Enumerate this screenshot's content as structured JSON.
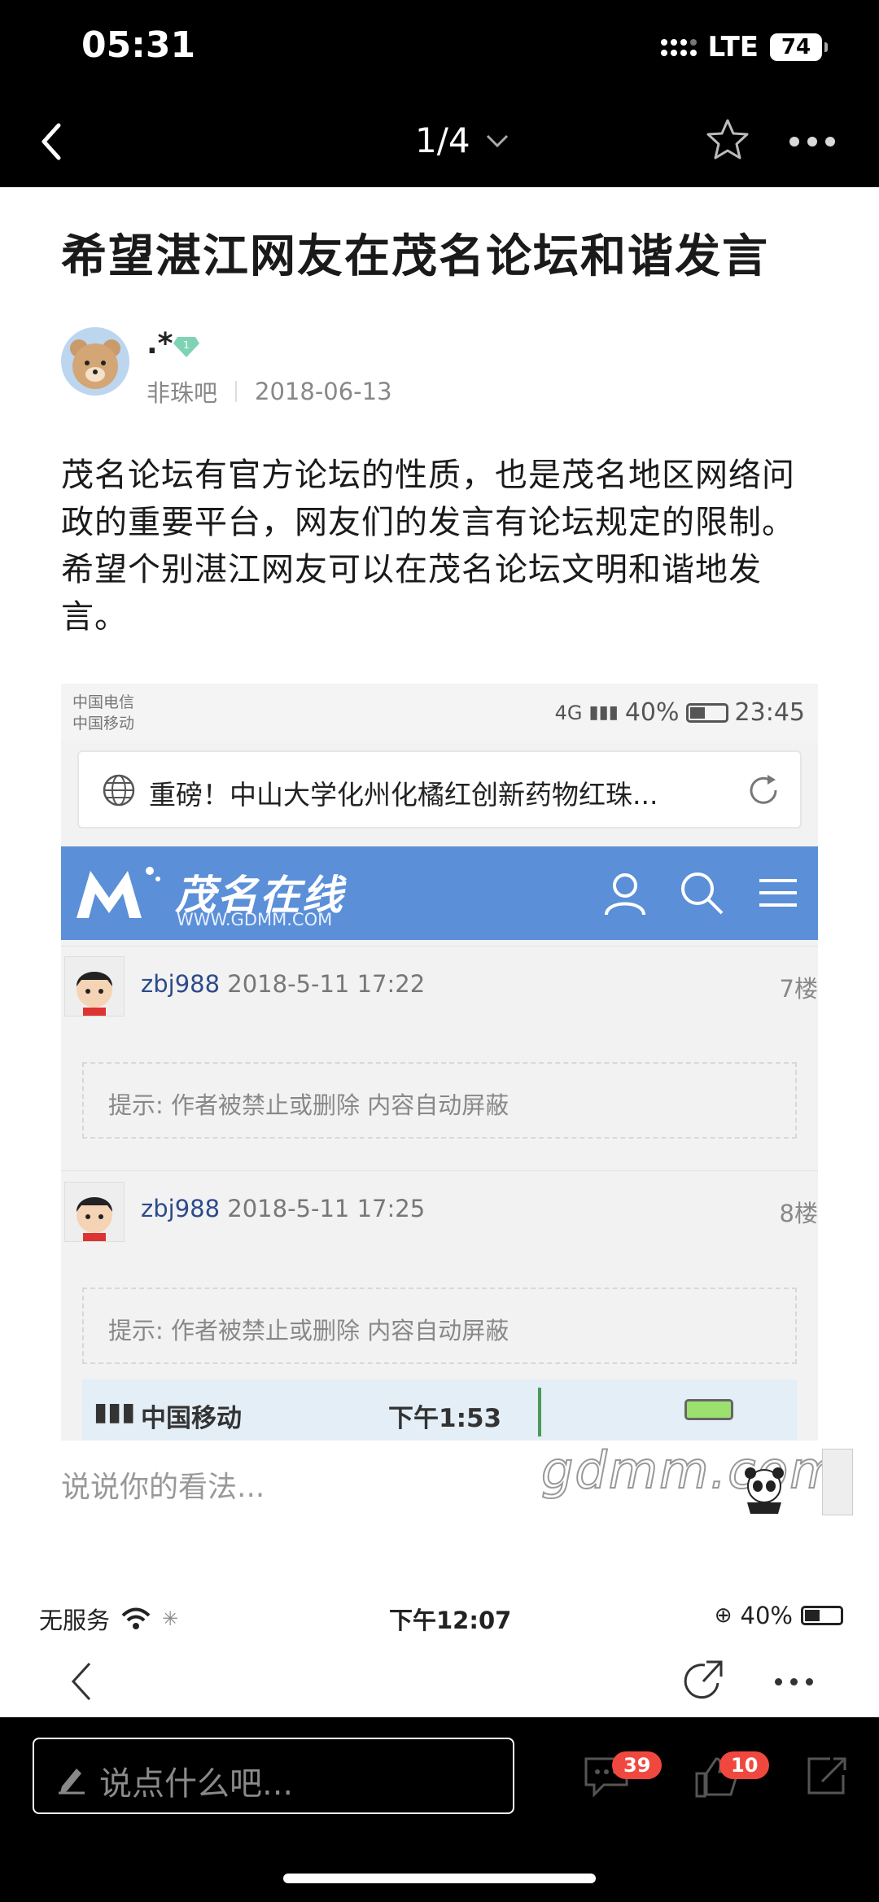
{
  "status_bar": {
    "time": "05:31",
    "network": "LTE",
    "battery": "74"
  },
  "nav": {
    "page_indicator": "1/4"
  },
  "article": {
    "title": "希望湛江网友在茂名论坛和谐发言",
    "author": ".*",
    "badge_level": "1",
    "forum": "非珠吧",
    "date": "2018-06-13",
    "body": "茂名论坛有官方论坛的性质，也是茂名地区网络问政的重要平台，网友们的发言有论坛规定的限制。希望个别湛江网友可以在茂名论坛文明和谐地发言。"
  },
  "embedded_screenshot": {
    "carrier_1": "中国电信",
    "carrier_2": "中国移动",
    "network_labels": "4G",
    "battery": "40%",
    "time": "23:45",
    "url_title": "重磅！中山大学化州化橘红创新药物红珠...",
    "site_logo": "茂名在线",
    "site_url": "WWW.GDMM.COM",
    "posts": [
      {
        "user": "zbj988",
        "time": "2018-5-11 17:22",
        "floor": "7楼",
        "notice": "提示: 作者被禁止或删除 内容自动屏蔽"
      },
      {
        "user": "zbj988",
        "time": "2018-5-11 17:25",
        "floor": "8楼",
        "notice": "提示: 作者被禁止或删除 内容自动屏蔽"
      }
    ],
    "bottom_strip": {
      "carrier": "中国移动",
      "time": "下午1:53"
    }
  },
  "comment_prompt": "说说你的看法...",
  "watermark": "gdmm.com",
  "inner_status": {
    "service": "无服务",
    "time": "下午12:07",
    "battery": "40%"
  },
  "bottom_bar": {
    "input_placeholder": "说点什么吧...",
    "comment_count": "39",
    "like_count": "10"
  }
}
